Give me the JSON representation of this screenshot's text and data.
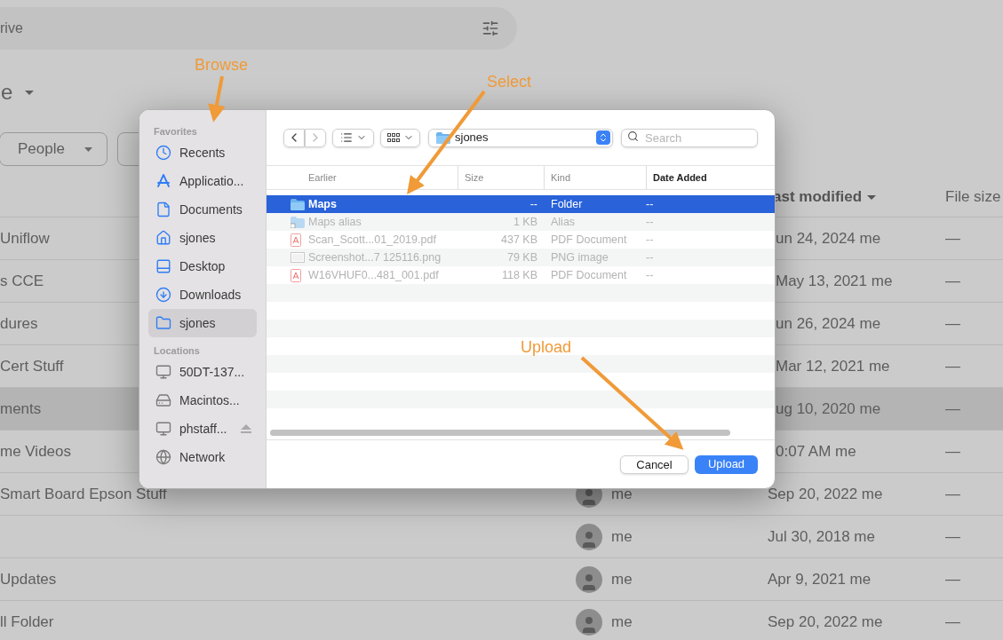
{
  "search": {
    "value": "rive"
  },
  "heading": {
    "text": "e"
  },
  "filters": [
    {
      "label": "People",
      "kind": "dropdown"
    },
    {
      "kind": "chip"
    }
  ],
  "table": {
    "columns": [
      {
        "label": "ast modified",
        "sorted": true
      },
      {
        "label": "File size",
        "sorted": false
      }
    ],
    "rows": [
      {
        "name": "Uniflow",
        "modified": "un 24, 2024 me",
        "size": "—",
        "hovered": false
      },
      {
        "name": "s CCE",
        "modified": "May 13, 2021 me",
        "size": "—",
        "hovered": false
      },
      {
        "name": "dures",
        "modified": "un 26, 2024 me",
        "size": "—",
        "hovered": false
      },
      {
        "name": "Cert Stuff",
        "modified": "Mar 12, 2021 me",
        "size": "—",
        "hovered": false
      },
      {
        "name": "ments",
        "modified": "ug 10, 2020 me",
        "size": "—",
        "hovered": true
      },
      {
        "name": "me Videos",
        "modified": "0:07 AM me",
        "size": "—",
        "hovered": false
      },
      {
        "name": "Smart Board Epson Stuff",
        "owner": "me",
        "modified": "Sep 20, 2022 me",
        "size": "—",
        "hovered": false
      },
      {
        "owner": "me",
        "modified": "Jul 30, 2018 me",
        "size": "—",
        "hovered": false
      },
      {
        "name": "Updates",
        "owner": "me",
        "modified": "Apr 9, 2021 me",
        "size": "—",
        "hovered": false
      },
      {
        "name": "ll Folder",
        "owner": "me",
        "modified": "Sep 20, 2022 me",
        "size": "—",
        "hovered": false
      }
    ]
  },
  "dialog": {
    "sidebar": [
      {
        "heading": "Favorites",
        "items": [
          {
            "label": "Recents",
            "kind": "clock",
            "selected": false
          },
          {
            "label": "Applicatio...",
            "kind": "apps",
            "selected": false
          },
          {
            "label": "Documents",
            "kind": "document",
            "selected": false
          },
          {
            "label": "sjones",
            "kind": "home",
            "selected": false
          },
          {
            "label": "Desktop",
            "kind": "desktop",
            "selected": false
          },
          {
            "label": "Downloads",
            "kind": "download",
            "selected": false
          },
          {
            "label": "sjones",
            "kind": "folder",
            "selected": true
          }
        ]
      },
      {
        "heading": "Locations",
        "items": [
          {
            "label": "50DT-137...",
            "kind": "computer",
            "selected": false,
            "ejectable": false
          },
          {
            "label": "Macintos...",
            "kind": "disk",
            "selected": false,
            "ejectable": false
          },
          {
            "label": "phstaff...",
            "kind": "server",
            "selected": false,
            "ejectable": true
          },
          {
            "label": "Network",
            "kind": "network",
            "selected": false,
            "ejectable": false
          }
        ]
      }
    ],
    "path": "sjones",
    "search": {
      "placeholder": "Search"
    },
    "columns": [
      {
        "label": "Earlier",
        "sorted": false
      },
      {
        "label": "Size",
        "sorted": false
      },
      {
        "label": "Kind",
        "sorted": false
      },
      {
        "label": "Date Added",
        "sorted": true
      }
    ],
    "files": [
      {
        "name": "Maps",
        "size": "--",
        "type": "Folder",
        "date": "--",
        "kind": "folder",
        "selected": true,
        "disabled": false
      },
      {
        "name": "Maps alias",
        "size": "1 KB",
        "type": "Alias",
        "date": "--",
        "kind": "alias",
        "selected": false,
        "disabled": true
      },
      {
        "name": "Scan_Scott...01_2019.pdf",
        "size": "437 KB",
        "type": "PDF Document",
        "date": "--",
        "kind": "pdf",
        "selected": false,
        "disabled": true
      },
      {
        "name": "Screenshot...7 125116.png",
        "size": "79 KB",
        "type": "PNG image",
        "date": "--",
        "kind": "image",
        "selected": false,
        "disabled": true
      },
      {
        "name": "W16VHUF0...481_001.pdf",
        "size": "118 KB",
        "type": "PDF Document",
        "date": "--",
        "kind": "pdf",
        "selected": false,
        "disabled": true
      }
    ],
    "buttons": [
      {
        "label": "Cancel",
        "primary": false
      },
      {
        "label": "Upload",
        "primary": true
      }
    ]
  },
  "annotations": [
    {
      "text": "Browse"
    },
    {
      "text": "Select"
    },
    {
      "text": "Upload"
    }
  ]
}
